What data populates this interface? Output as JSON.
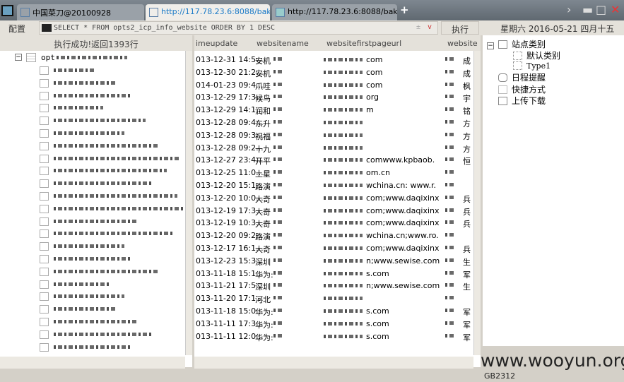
{
  "tabs": [
    {
      "label": "中国菜刀@20100928"
    },
    {
      "label": "http://117.78.23.6:8088/bak...."
    },
    {
      "label": "http://117.78.23.6:8088/bak...."
    }
  ],
  "toolbar": {
    "config_label": "配置",
    "sql_query": "SELECT * FROM opts2_icp_info_website ORDER BY 1 DESC",
    "execute_label": "执行",
    "date_text": "星期六 2016-05-21 四月十五"
  },
  "left_panel": {
    "status": "执行成功!返回1393行",
    "table_name": "opt"
  },
  "grid": {
    "columns": [
      "imeupdate",
      "websitename",
      "websitefirstpageurl",
      "website"
    ],
    "rows": [
      [
        "013-12-31 14:5...",
        "安机",
        "com",
        "成"
      ],
      [
        "013-12-30 21:2...",
        "安机",
        "com",
        "成"
      ],
      [
        "014-01-23 09:4...",
        "爪哇",
        "com",
        "枫"
      ],
      [
        "013-12-29 17:3...",
        "候鸟",
        "org",
        "宇"
      ],
      [
        "013-12-29 14:1...",
        "润和",
        "m",
        "铭"
      ],
      [
        "013-12-28 09:4...",
        "东升",
        "",
        "方"
      ],
      [
        "013-12-28 09:3...",
        "祝福",
        "",
        "方"
      ],
      [
        "013-12-28 09:2...",
        "十九",
        "",
        "方"
      ],
      [
        "013-12-27 23:4...",
        "开平",
        "comwww.kpbaob.",
        "恒"
      ],
      [
        "013-12-25 11:0...",
        "土星",
        "om.cn",
        ""
      ],
      [
        "013-12-20 15:1...",
        "路演",
        "wchina.cn: www.r.",
        ""
      ],
      [
        "013-12-20 10:0...",
        "大奇",
        "com;www.daqixinx",
        "兵"
      ],
      [
        "013-12-19 17:3...",
        "大奇",
        "com;www.daqixinx",
        "兵"
      ],
      [
        "013-12-19 10:3...",
        "大奇",
        "com;www.daqixinx",
        "兵"
      ],
      [
        "013-12-20 09:2...",
        "路演",
        "wchina.cn;www.ro.",
        ""
      ],
      [
        "013-12-17 16:1...",
        "大奇",
        "com;www.daqixinx",
        "兵"
      ],
      [
        "013-12-23 15:3...",
        "深圳",
        "n;www.sewise.com",
        "生"
      ],
      [
        "013-11-18 15:1...",
        "华为:",
        "s.com",
        "军"
      ],
      [
        "013-11-21 17:5...",
        "深圳",
        "n;www.sewise.com",
        "生"
      ],
      [
        "013-11-20 17:1...",
        "河北",
        "",
        ""
      ],
      [
        "013-11-18 15:0...",
        "华为:",
        "s.com",
        "军"
      ],
      [
        "013-11-11 17:3...",
        "华为:",
        "s.com",
        "军"
      ],
      [
        "013-11-11 12:0...",
        "华为:",
        "s.com",
        "军"
      ]
    ]
  },
  "right_panel": {
    "site_category": "站点类别",
    "default_category": "默认类别",
    "type1": "Type1",
    "schedule": "日程提醒",
    "shortcuts": "快捷方式",
    "upload_download": "上传下载"
  },
  "watermark": "www.wooyun.org",
  "encoding": "GB2312"
}
